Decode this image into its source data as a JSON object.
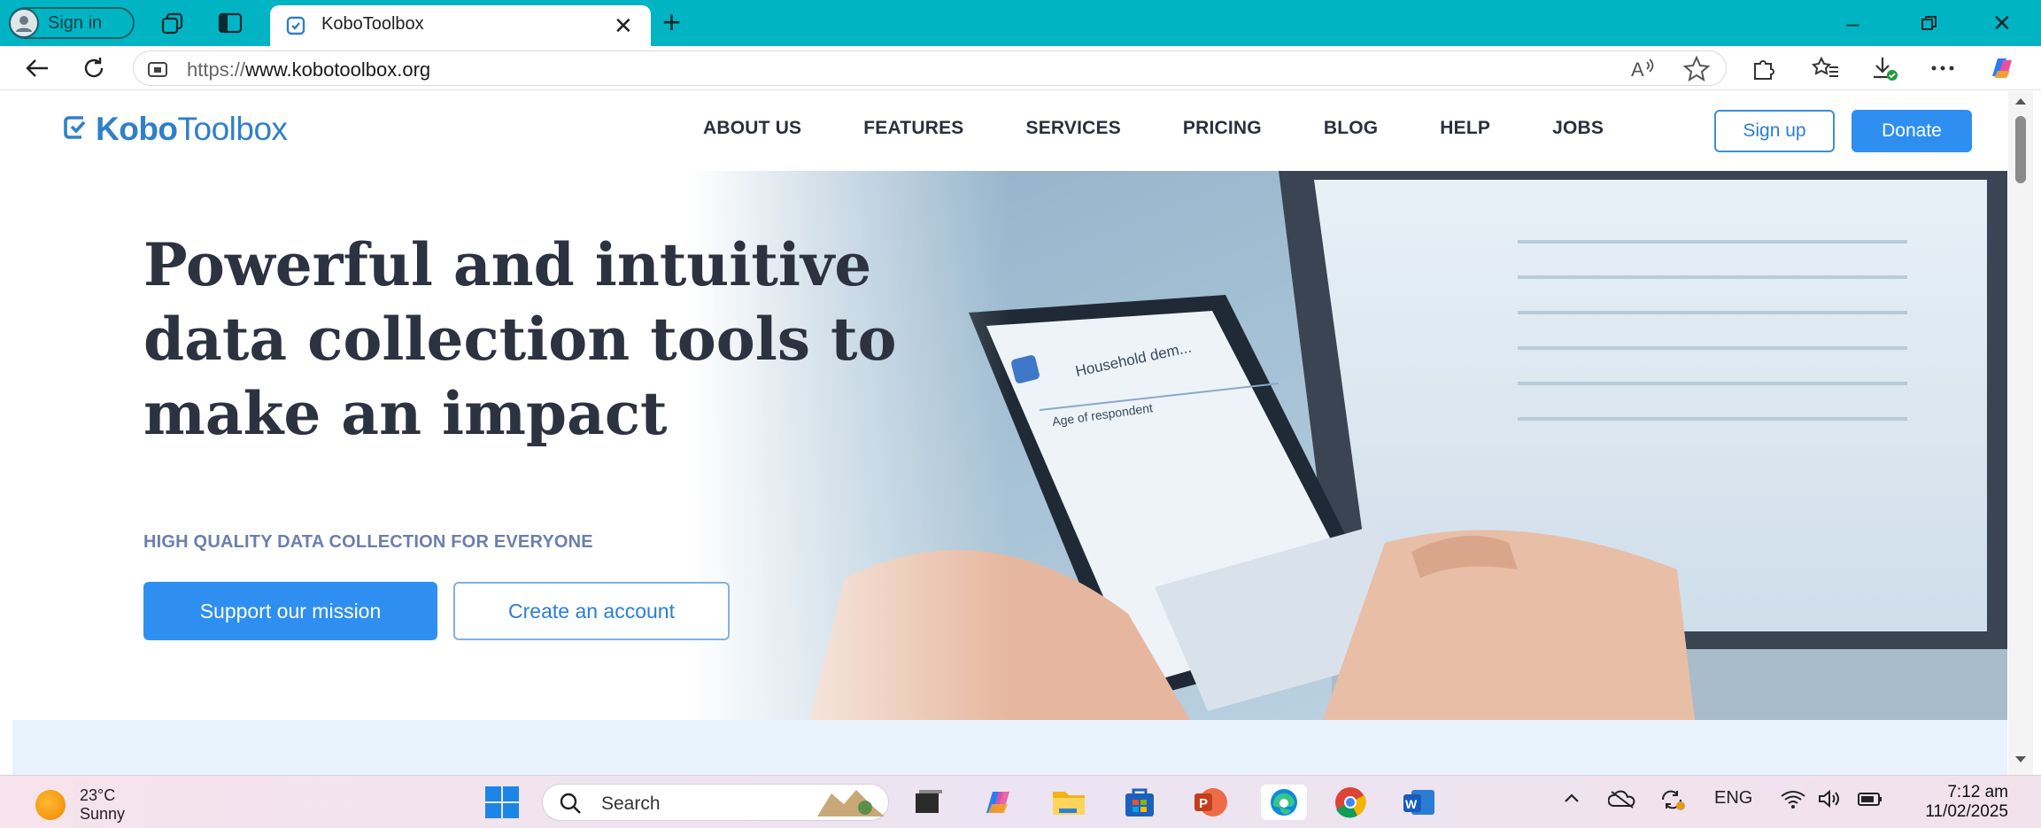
{
  "browser": {
    "profile_label": "Sign in",
    "tab_title": "KoboToolbox",
    "url_protocol": "https://",
    "url_host": "www.kobotoolbox.org"
  },
  "site": {
    "logo_prefix": "Kobo",
    "logo_suffix": "Toolbox",
    "nav": [
      "ABOUT US",
      "FEATURES",
      "SERVICES",
      "PRICING",
      "BLOG",
      "HELP",
      "JOBS"
    ],
    "signup_label": "Sign up",
    "donate_label": "Donate",
    "headline": "Powerful and intuitive data collection tools to make an impact",
    "eyebrow": "HIGH QUALITY DATA COLLECTION FOR EVERYONE",
    "primary_cta": "Support our mission",
    "secondary_cta": "Create an account",
    "phone_form_title": "Household dem...",
    "phone_form_question": "Age of respondent"
  },
  "taskbar": {
    "temperature": "23°C",
    "condition": "Sunny",
    "search_placeholder": "Search",
    "language": "ENG",
    "time": "7:12 am",
    "date": "11/02/2025"
  },
  "colors": {
    "titlebar": "#00b4c3",
    "brand_blue": "#2f8ff0",
    "headline": "#2d3240"
  },
  "icons": [
    "profile-avatar-icon",
    "workspaces-icon",
    "vertical-tabs-icon",
    "tab-favicon",
    "tab-close-icon",
    "new-tab-icon",
    "minimize-icon",
    "restore-icon",
    "close-window-icon",
    "back-icon",
    "refresh-icon",
    "site-info-icon",
    "read-aloud-icon",
    "favorite-star-icon",
    "extensions-icon",
    "favorites-icon",
    "downloads-icon",
    "more-icon",
    "copilot-icon",
    "windows-start-icon",
    "search-icon",
    "task-view-icon",
    "copilot-app-icon",
    "file-explorer-icon",
    "store-icon",
    "powerpoint-icon",
    "edge-icon",
    "chrome-icon",
    "word-icon",
    "tray-chevron-icon",
    "onedrive-icon",
    "sync-icon",
    "wifi-icon",
    "volume-icon",
    "battery-icon"
  ]
}
